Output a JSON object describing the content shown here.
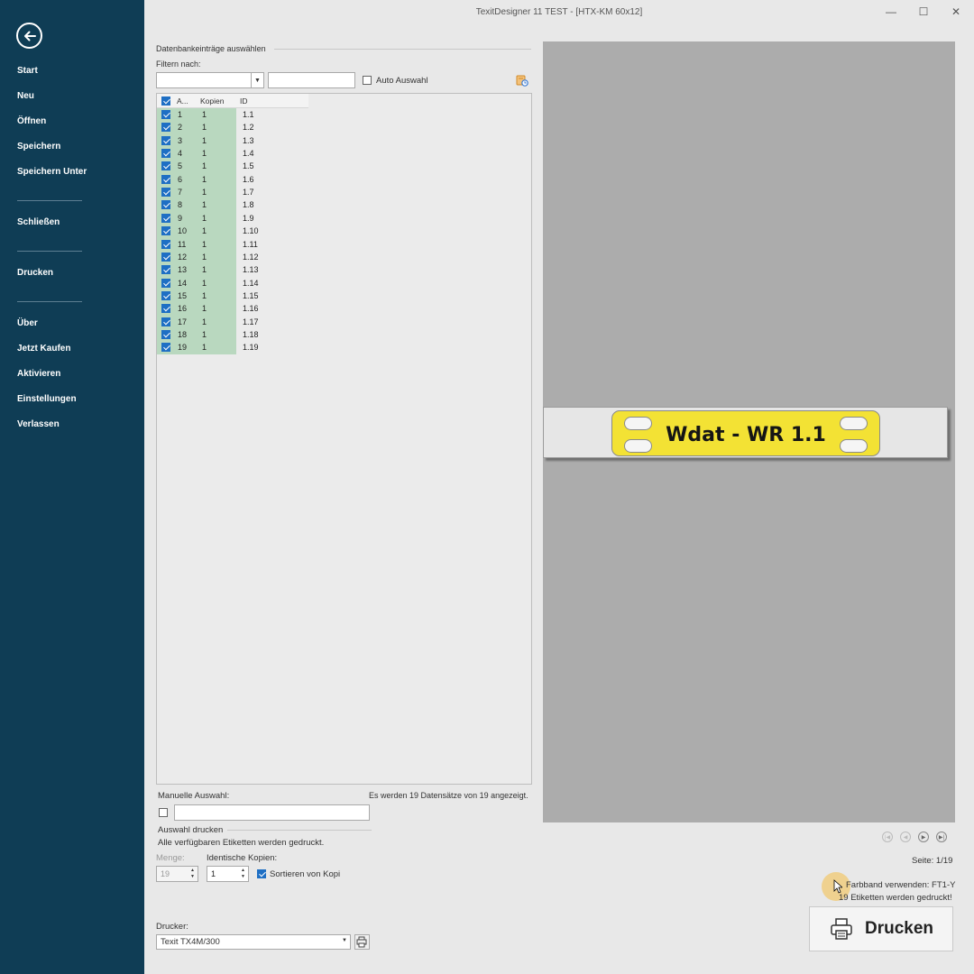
{
  "window": {
    "title": "TexitDesigner 11 TEST - [HTX-KM 60x12]",
    "minimize_symbol": "—",
    "maximize_symbol": "☐",
    "close_symbol": "✕"
  },
  "sidebar": {
    "back_icon": "back-arrow-icon",
    "items": [
      {
        "label": "Start"
      },
      {
        "label": "Neu"
      },
      {
        "label": "Öffnen"
      },
      {
        "label": "Speichern"
      },
      {
        "label": "Speichern Unter"
      },
      {
        "label": "Schließen"
      },
      {
        "label": "Drucken"
      },
      {
        "label": "Über"
      },
      {
        "label": "Jetzt Kaufen"
      },
      {
        "label": "Aktivieren"
      },
      {
        "label": "Einstellungen"
      },
      {
        "label": "Verlassen"
      }
    ]
  },
  "records": {
    "group_title": "Datenbankeinträge auswählen",
    "filter_label": "Filtern nach:",
    "filter_combo_value": "",
    "filter_text_value": "",
    "auto_select_label": "Auto Auswahl",
    "auto_select_checked": false,
    "columns": [
      "A...",
      "Kopien",
      "ID"
    ],
    "header_checked": true,
    "rows": [
      {
        "a": "1",
        "kopien": "1",
        "id": "1.1",
        "checked": true
      },
      {
        "a": "2",
        "kopien": "1",
        "id": "1.2",
        "checked": true
      },
      {
        "a": "3",
        "kopien": "1",
        "id": "1.3",
        "checked": true
      },
      {
        "a": "4",
        "kopien": "1",
        "id": "1.4",
        "checked": true
      },
      {
        "a": "5",
        "kopien": "1",
        "id": "1.5",
        "checked": true
      },
      {
        "a": "6",
        "kopien": "1",
        "id": "1.6",
        "checked": true
      },
      {
        "a": "7",
        "kopien": "1",
        "id": "1.7",
        "checked": true
      },
      {
        "a": "8",
        "kopien": "1",
        "id": "1.8",
        "checked": true
      },
      {
        "a": "9",
        "kopien": "1",
        "id": "1.9",
        "checked": true
      },
      {
        "a": "10",
        "kopien": "1",
        "id": "1.10",
        "checked": true
      },
      {
        "a": "11",
        "kopien": "1",
        "id": "1.11",
        "checked": true
      },
      {
        "a": "12",
        "kopien": "1",
        "id": "1.12",
        "checked": true
      },
      {
        "a": "13",
        "kopien": "1",
        "id": "1.13",
        "checked": true
      },
      {
        "a": "14",
        "kopien": "1",
        "id": "1.14",
        "checked": true
      },
      {
        "a": "15",
        "kopien": "1",
        "id": "1.15",
        "checked": true
      },
      {
        "a": "16",
        "kopien": "1",
        "id": "1.16",
        "checked": true
      },
      {
        "a": "17",
        "kopien": "1",
        "id": "1.17",
        "checked": true
      },
      {
        "a": "18",
        "kopien": "1",
        "id": "1.18",
        "checked": true
      },
      {
        "a": "19",
        "kopien": "1",
        "id": "1.19",
        "checked": true
      }
    ],
    "manual_label": "Manuelle Auswahl:",
    "manual_value": "",
    "status_text": "Es werden 19 Datensätze von 19 angezeigt."
  },
  "print_selection": {
    "title": "Auswahl drucken",
    "description": "Alle verfügbaren Etiketten werden gedruckt.",
    "menge_label": "Menge:",
    "menge_value": "19",
    "kopien_label": "Identische Kopien:",
    "kopien_value": "1",
    "sort_label": "Sortieren von Kopi",
    "sort_checked": true
  },
  "printer": {
    "label": "Drucker:",
    "value": "Texit TX4M/300"
  },
  "preview": {
    "label_text": "Wdat - WR 1.1",
    "label_color": "#f3e234",
    "page": "Seite: 1/19",
    "ribbon": "Farbband verwenden: FT1-Y",
    "count": "19 Etiketten werden gedruckt!"
  },
  "print_button": {
    "label": "Drucken",
    "icon": "printer-icon"
  },
  "colors": {
    "sidebar_bg": "#0f3d55",
    "selection_green": "#b9d8bf",
    "checkbox_blue": "#1e6fc4"
  }
}
